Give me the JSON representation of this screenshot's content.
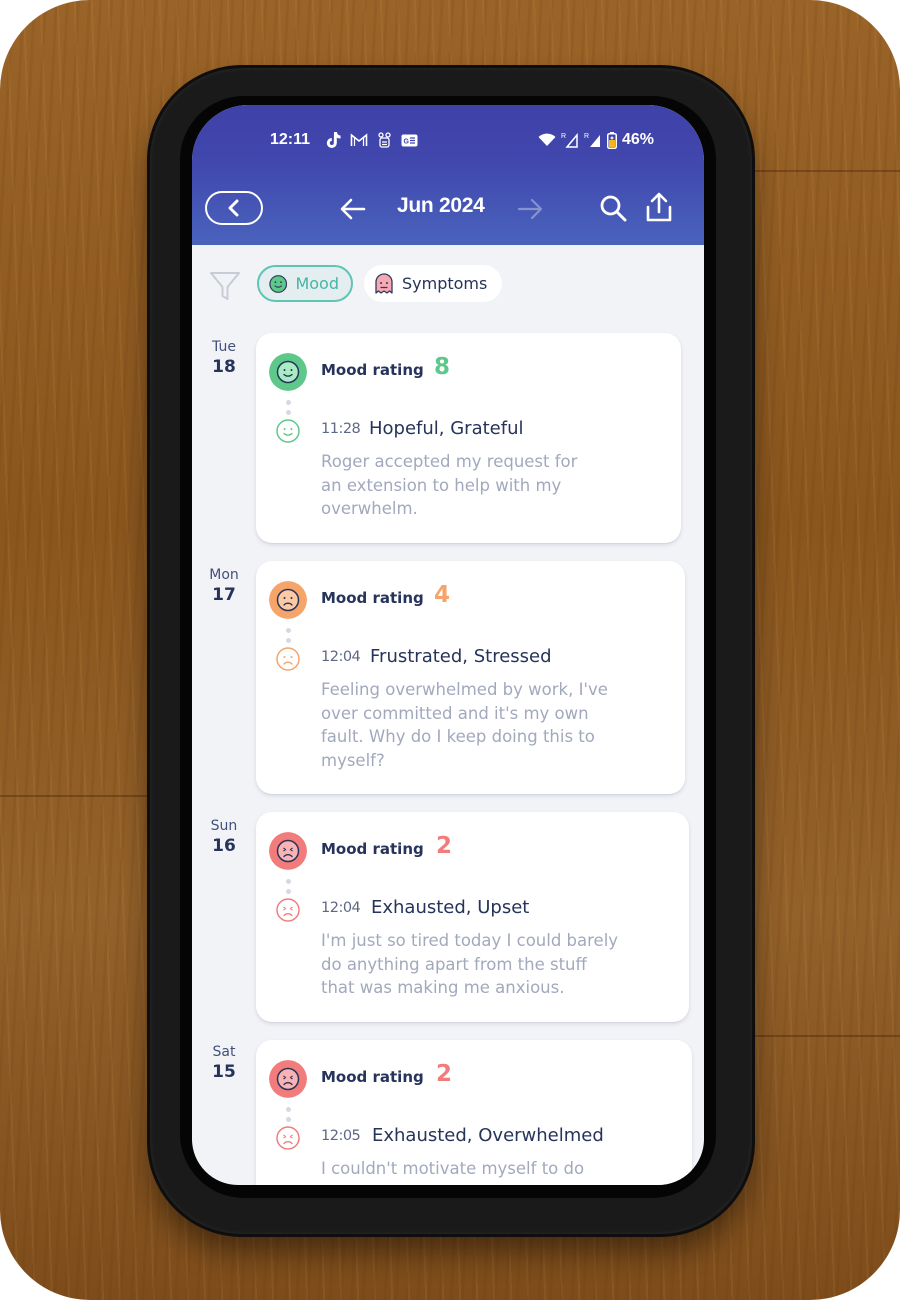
{
  "status_bar": {
    "time": "12:11",
    "notification_icons": [
      "tiktok-icon",
      "gmail-icon",
      "app-icon",
      "news-icon"
    ],
    "battery_percent": "46%",
    "signal_indicators": [
      "wifi-icon",
      "signal-roaming-icon",
      "signal-roaming-icon",
      "battery-charging-icon"
    ]
  },
  "header": {
    "title": "Jun 2024",
    "back_icon": "chevron-left-icon",
    "prev_icon": "arrow-left-icon",
    "next_icon": "arrow-right-icon",
    "search_icon": "search-icon",
    "share_icon": "share-icon"
  },
  "filters": {
    "filter_icon": "funnel-icon",
    "chips": [
      {
        "label": "Mood",
        "active": true,
        "icon": "smiley-icon"
      },
      {
        "label": "Symptoms",
        "active": false,
        "icon": "ghost-icon"
      }
    ]
  },
  "colors": {
    "header": "#4047ad",
    "good": "#5dc88a",
    "medium": "#f5a46a",
    "bad": "#f27c7c",
    "text_primary": "#26335a",
    "text_muted": "#a2a9bd",
    "chip_active": "#45b5a4"
  },
  "entries": [
    {
      "dow": "Tue",
      "day": "18",
      "rating_label": "Mood rating",
      "rating": "8",
      "mood": "good",
      "time": "11:28",
      "emotions": "Hopeful, Grateful",
      "note": "Roger accepted my request for\nan extension to help with my\noverwhelm."
    },
    {
      "dow": "Mon",
      "day": "17",
      "rating_label": "Mood rating",
      "rating": "4",
      "mood": "medium",
      "time": "12:04",
      "emotions": "Frustrated, Stressed",
      "note": "Feeling overwhelmed by work, I've\nover committed and it's my own\nfault. Why do I keep doing this to\nmyself?"
    },
    {
      "dow": "Sun",
      "day": "16",
      "rating_label": "Mood rating",
      "rating": "2",
      "mood": "bad",
      "time": "12:04",
      "emotions": "Exhausted, Upset",
      "note": "I'm just so tired today I could barely\ndo anything apart from the stuff\nthat was making me anxious."
    },
    {
      "dow": "Sat",
      "day": "15",
      "rating_label": "Mood rating",
      "rating": "2",
      "mood": "bad",
      "time": "12:05",
      "emotions": "Exhausted, Overwhelmed",
      "note": "I couldn't motivate myself to do"
    }
  ]
}
